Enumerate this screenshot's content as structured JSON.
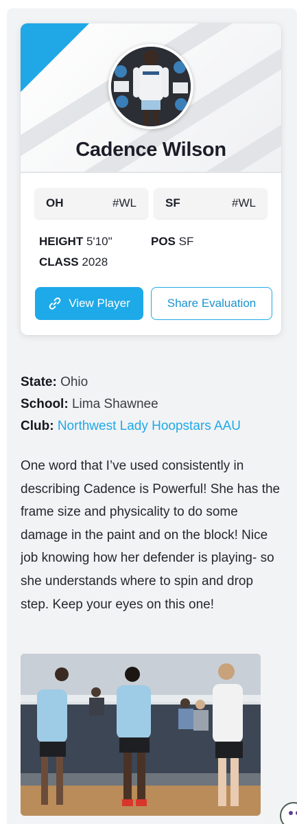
{
  "player": {
    "name": "Cadence Wilson"
  },
  "ranks": [
    {
      "scope": "OH",
      "rank": "#WL"
    },
    {
      "scope": "SF",
      "rank": "#WL"
    }
  ],
  "stats": {
    "height_label": "HEIGHT",
    "height_value": "5'10\"",
    "pos_label": "POS",
    "pos_value": "SF",
    "class_label": "CLASS",
    "class_value": "2028"
  },
  "buttons": {
    "view_player": "View Player",
    "share_evaluation": "Share Evaluation"
  },
  "details": {
    "state_label": "State:",
    "state_value": "Ohio",
    "school_label": "School:",
    "school_value": "Lima Shawnee",
    "club_label": "Club:",
    "club_value": "Northwest Lady Hoopstars AAU"
  },
  "evaluation": "One word that I’ve used consistently in describing Cadence is Powerful! She has the frame size and physicality to do some damage in the paint and on the block! Nice job knowing how her defender is playing- so she understands where to spin and drop step. Keep your eyes on this one!",
  "colors": {
    "accent": "#1ea9e8",
    "name_text": "#1b1d29",
    "page_panel": "#f2f3f5"
  },
  "icons": {
    "view_player": "link-icon",
    "floating": "chat-widget-icon"
  }
}
